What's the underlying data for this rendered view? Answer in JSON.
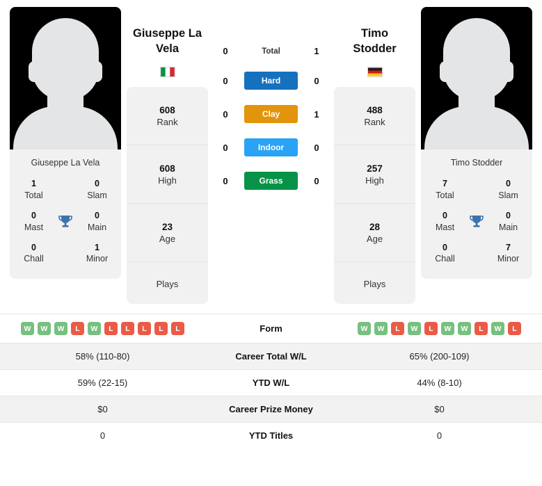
{
  "players": {
    "left": {
      "name": "Giuseppe La Vela",
      "display_name_line1": "Giuseppe La",
      "display_name_line2": "Vela",
      "country": "Italy",
      "flag": "it",
      "rank": "608",
      "rank_label": "Rank",
      "high": "608",
      "high_label": "High",
      "age": "23",
      "age_label": "Age",
      "plays": "",
      "plays_label": "Plays",
      "titles": {
        "total": "1",
        "total_label": "Total",
        "slam": "0",
        "slam_label": "Slam",
        "mast": "0",
        "mast_label": "Mast",
        "main": "0",
        "main_label": "Main",
        "chall": "0",
        "chall_label": "Chall",
        "minor": "1",
        "minor_label": "Minor"
      }
    },
    "right": {
      "name": "Timo Stodder",
      "display_name_line1": "Timo",
      "display_name_line2": "Stodder",
      "country": "Germany",
      "flag": "de",
      "rank": "488",
      "rank_label": "Rank",
      "high": "257",
      "high_label": "High",
      "age": "28",
      "age_label": "Age",
      "plays": "",
      "plays_label": "Plays",
      "titles": {
        "total": "7",
        "total_label": "Total",
        "slam": "0",
        "slam_label": "Slam",
        "mast": "0",
        "mast_label": "Mast",
        "main": "0",
        "main_label": "Main",
        "chall": "0",
        "chall_label": "Chall",
        "minor": "7",
        "minor_label": "Minor"
      }
    }
  },
  "head_to_head": [
    {
      "label": "Total",
      "left": "0",
      "right": "1",
      "style": "plain",
      "color": ""
    },
    {
      "label": "Hard",
      "left": "0",
      "right": "0",
      "style": "pill",
      "color": "#1571bd"
    },
    {
      "label": "Clay",
      "left": "0",
      "right": "1",
      "style": "pill",
      "color": "#e2940c"
    },
    {
      "label": "Indoor",
      "left": "0",
      "right": "0",
      "style": "pill",
      "color": "#28a3f5"
    },
    {
      "label": "Grass",
      "left": "0",
      "right": "0",
      "style": "pill",
      "color": "#069347"
    }
  ],
  "stats_table": {
    "form_label": "Form",
    "form_left": [
      "W",
      "W",
      "W",
      "L",
      "W",
      "L",
      "L",
      "L",
      "L",
      "L"
    ],
    "form_right": [
      "W",
      "W",
      "L",
      "W",
      "L",
      "W",
      "W",
      "L",
      "W",
      "L"
    ],
    "rows": [
      {
        "label": "Career Total W/L",
        "left": "58% (110-80)",
        "right": "65% (200-109)"
      },
      {
        "label": "YTD W/L",
        "left": "59% (22-15)",
        "right": "44% (8-10)"
      },
      {
        "label": "Career Prize Money",
        "left": "$0",
        "right": "$0"
      },
      {
        "label": "YTD Titles",
        "left": "0",
        "right": "0"
      }
    ]
  },
  "colors": {
    "badge_win": "#77c080",
    "badge_loss": "#ea5b47",
    "trophy": "#3f72ad",
    "card_bg": "#f1f1f1"
  }
}
